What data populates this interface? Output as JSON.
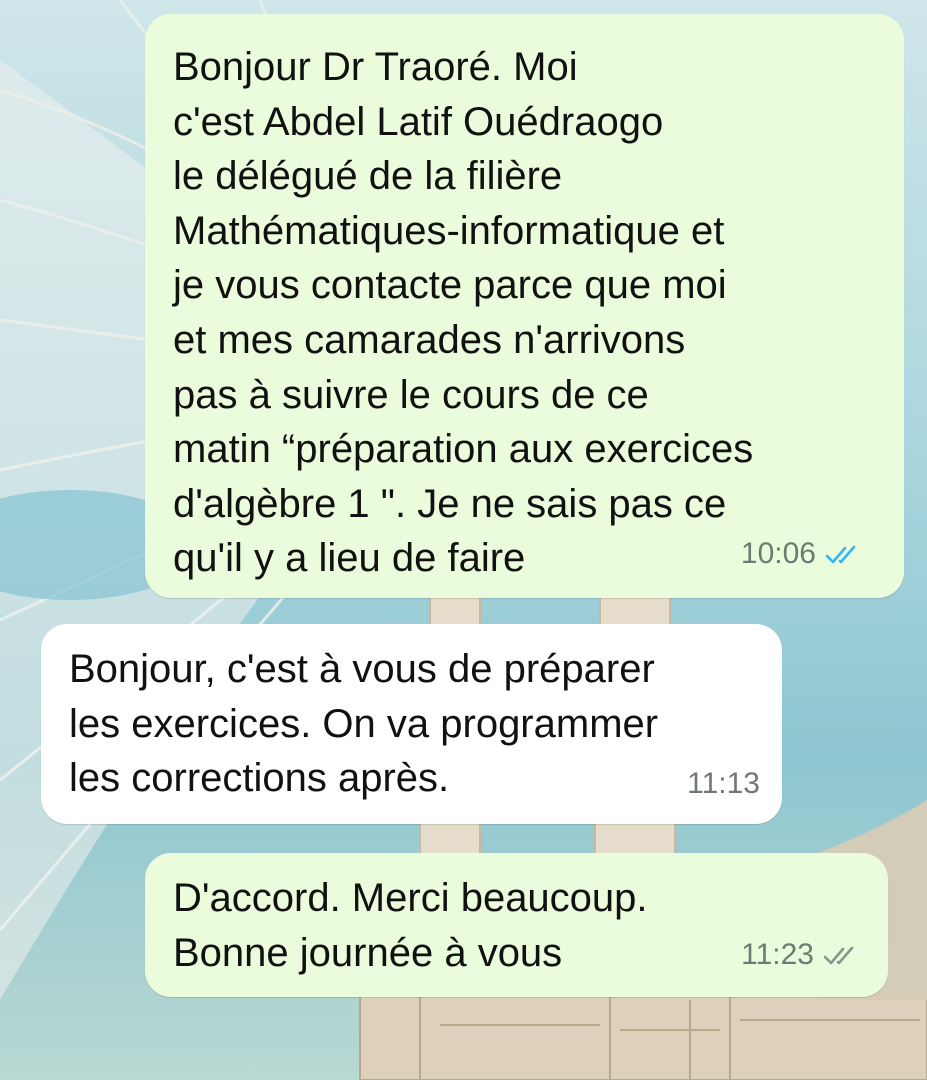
{
  "colors": {
    "outgoing_bubble": "#eafcdc",
    "incoming_bubble": "#ffffff",
    "read_ticks": "#34b7f1",
    "delivered_ticks": "#8a948e"
  },
  "messages": [
    {
      "direction": "outgoing",
      "text": "Bonjour Dr Traoré. Moi\nc'est Abdel Latif Ouédraogo\nle délégué de la filière\nMathématiques-informatique et\nje vous contacte parce que moi\net mes camarades n'arrivons\npas à suivre le cours de ce\nmatin “préparation aux exercices\nd'algèbre 1 \". Je ne sais pas ce\nqu'il y a lieu de faire",
      "time": "10:06",
      "status_icon": "double-check-read-icon"
    },
    {
      "direction": "incoming",
      "text": "Bonjour, c'est à vous de préparer\nles exercices. On va programmer\nles corrections après.",
      "time": "11:13"
    },
    {
      "direction": "outgoing",
      "text": "D'accord. Merci beaucoup.\nBonne journée à vous",
      "time": "11:23",
      "status_icon": "double-check-delivered-icon"
    }
  ]
}
